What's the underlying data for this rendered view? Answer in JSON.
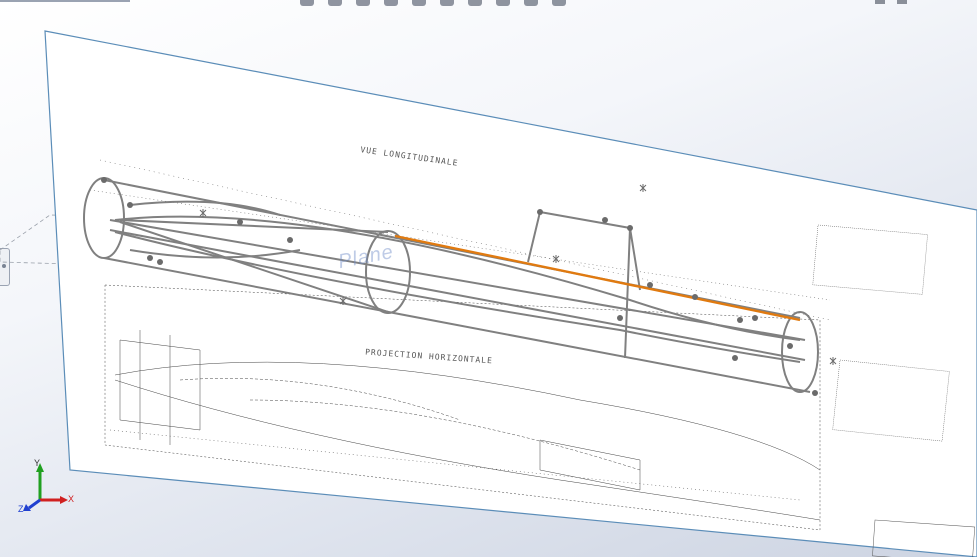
{
  "toolbar": {
    "icons": [
      "zoom-fit-icon",
      "zoom-area-icon",
      "previous-view-icon",
      "section-view-icon",
      "view-orientation-icon",
      "display-style-icon",
      "hide-show-icon",
      "edit-appearance-icon",
      "scenes-icon",
      "view-settings-icon"
    ]
  },
  "viewport": {
    "plane_label": "Plane",
    "drawing_titles": {
      "top_view": "VUE LONGITUDINALE",
      "section_view": "PROJECTION HORIZONTALE"
    },
    "triad": {
      "x": "X",
      "y": "Y",
      "z": "Z"
    }
  },
  "colors": {
    "sketch_line": "#808080",
    "selected_line": "#e07a10",
    "plane_border": "#5b8db8",
    "triad_x": "#d02020",
    "triad_y": "#20a020",
    "triad_z": "#2040d0"
  }
}
